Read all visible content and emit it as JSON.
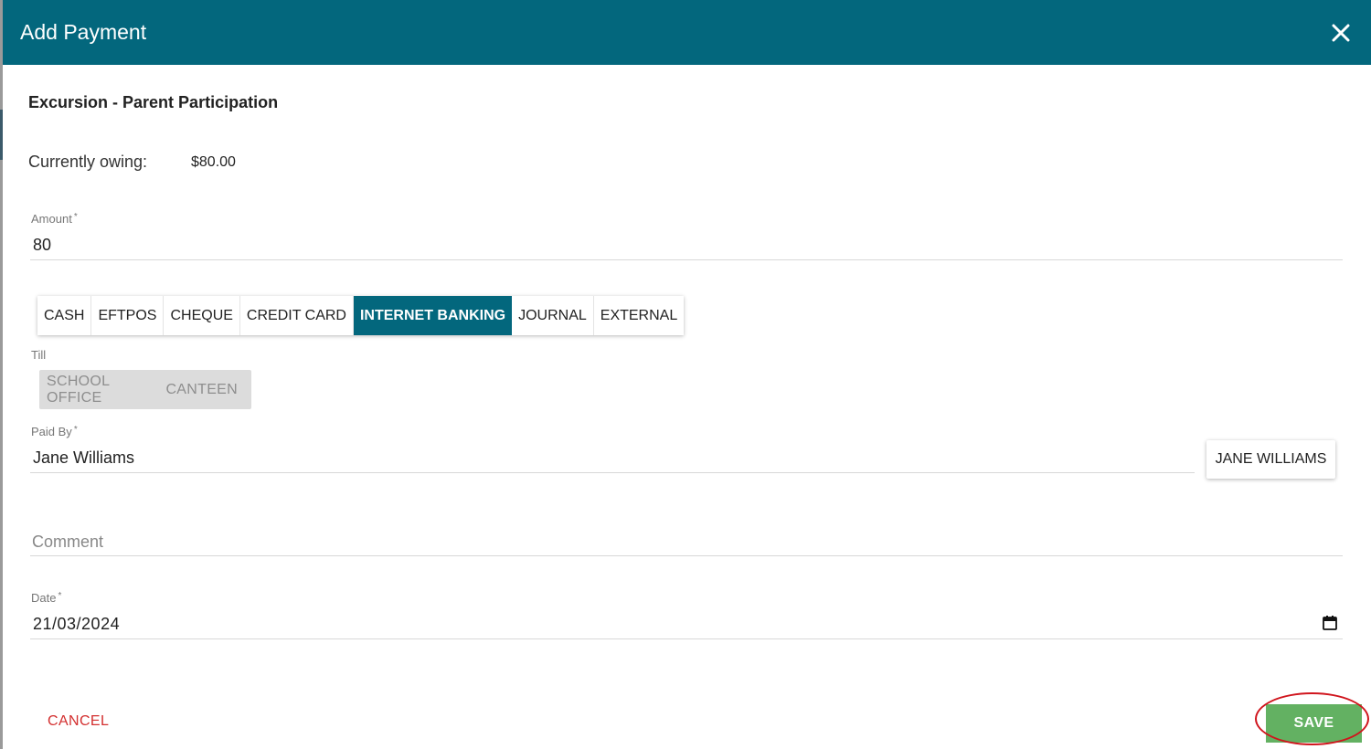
{
  "dialog": {
    "title": "Add Payment",
    "subtitle": "Excursion - Parent Participation"
  },
  "owing": {
    "label": "Currently owing:",
    "value": "$80.00"
  },
  "amount": {
    "label": "Amount",
    "required_mark": "*",
    "value": "80"
  },
  "payment_methods": {
    "items": [
      "CASH",
      "EFTPOS",
      "CHEQUE",
      "CREDIT CARD",
      "INTERNET BANKING",
      "JOURNAL",
      "EXTERNAL"
    ],
    "selected": "INTERNET BANKING"
  },
  "till": {
    "label": "Till",
    "options": [
      "SCHOOL OFFICE",
      "CANTEEN"
    ]
  },
  "paid_by": {
    "label": "Paid By",
    "required_mark": "*",
    "value": "Jane Williams",
    "payer_button": "JANE WILLIAMS"
  },
  "comment": {
    "placeholder": "Comment"
  },
  "date": {
    "label": "Date",
    "required_mark": "*",
    "value": "21/03/2024"
  },
  "actions": {
    "cancel": "CANCEL",
    "save": "SAVE"
  },
  "colors": {
    "header": "#03677d",
    "selected_method": "#03677d",
    "save": "#63b162",
    "cancel": "#d32f2f",
    "highlight_ring": "#d0151d"
  },
  "icons": {
    "close": "close-icon",
    "calendar": "calendar-icon"
  }
}
